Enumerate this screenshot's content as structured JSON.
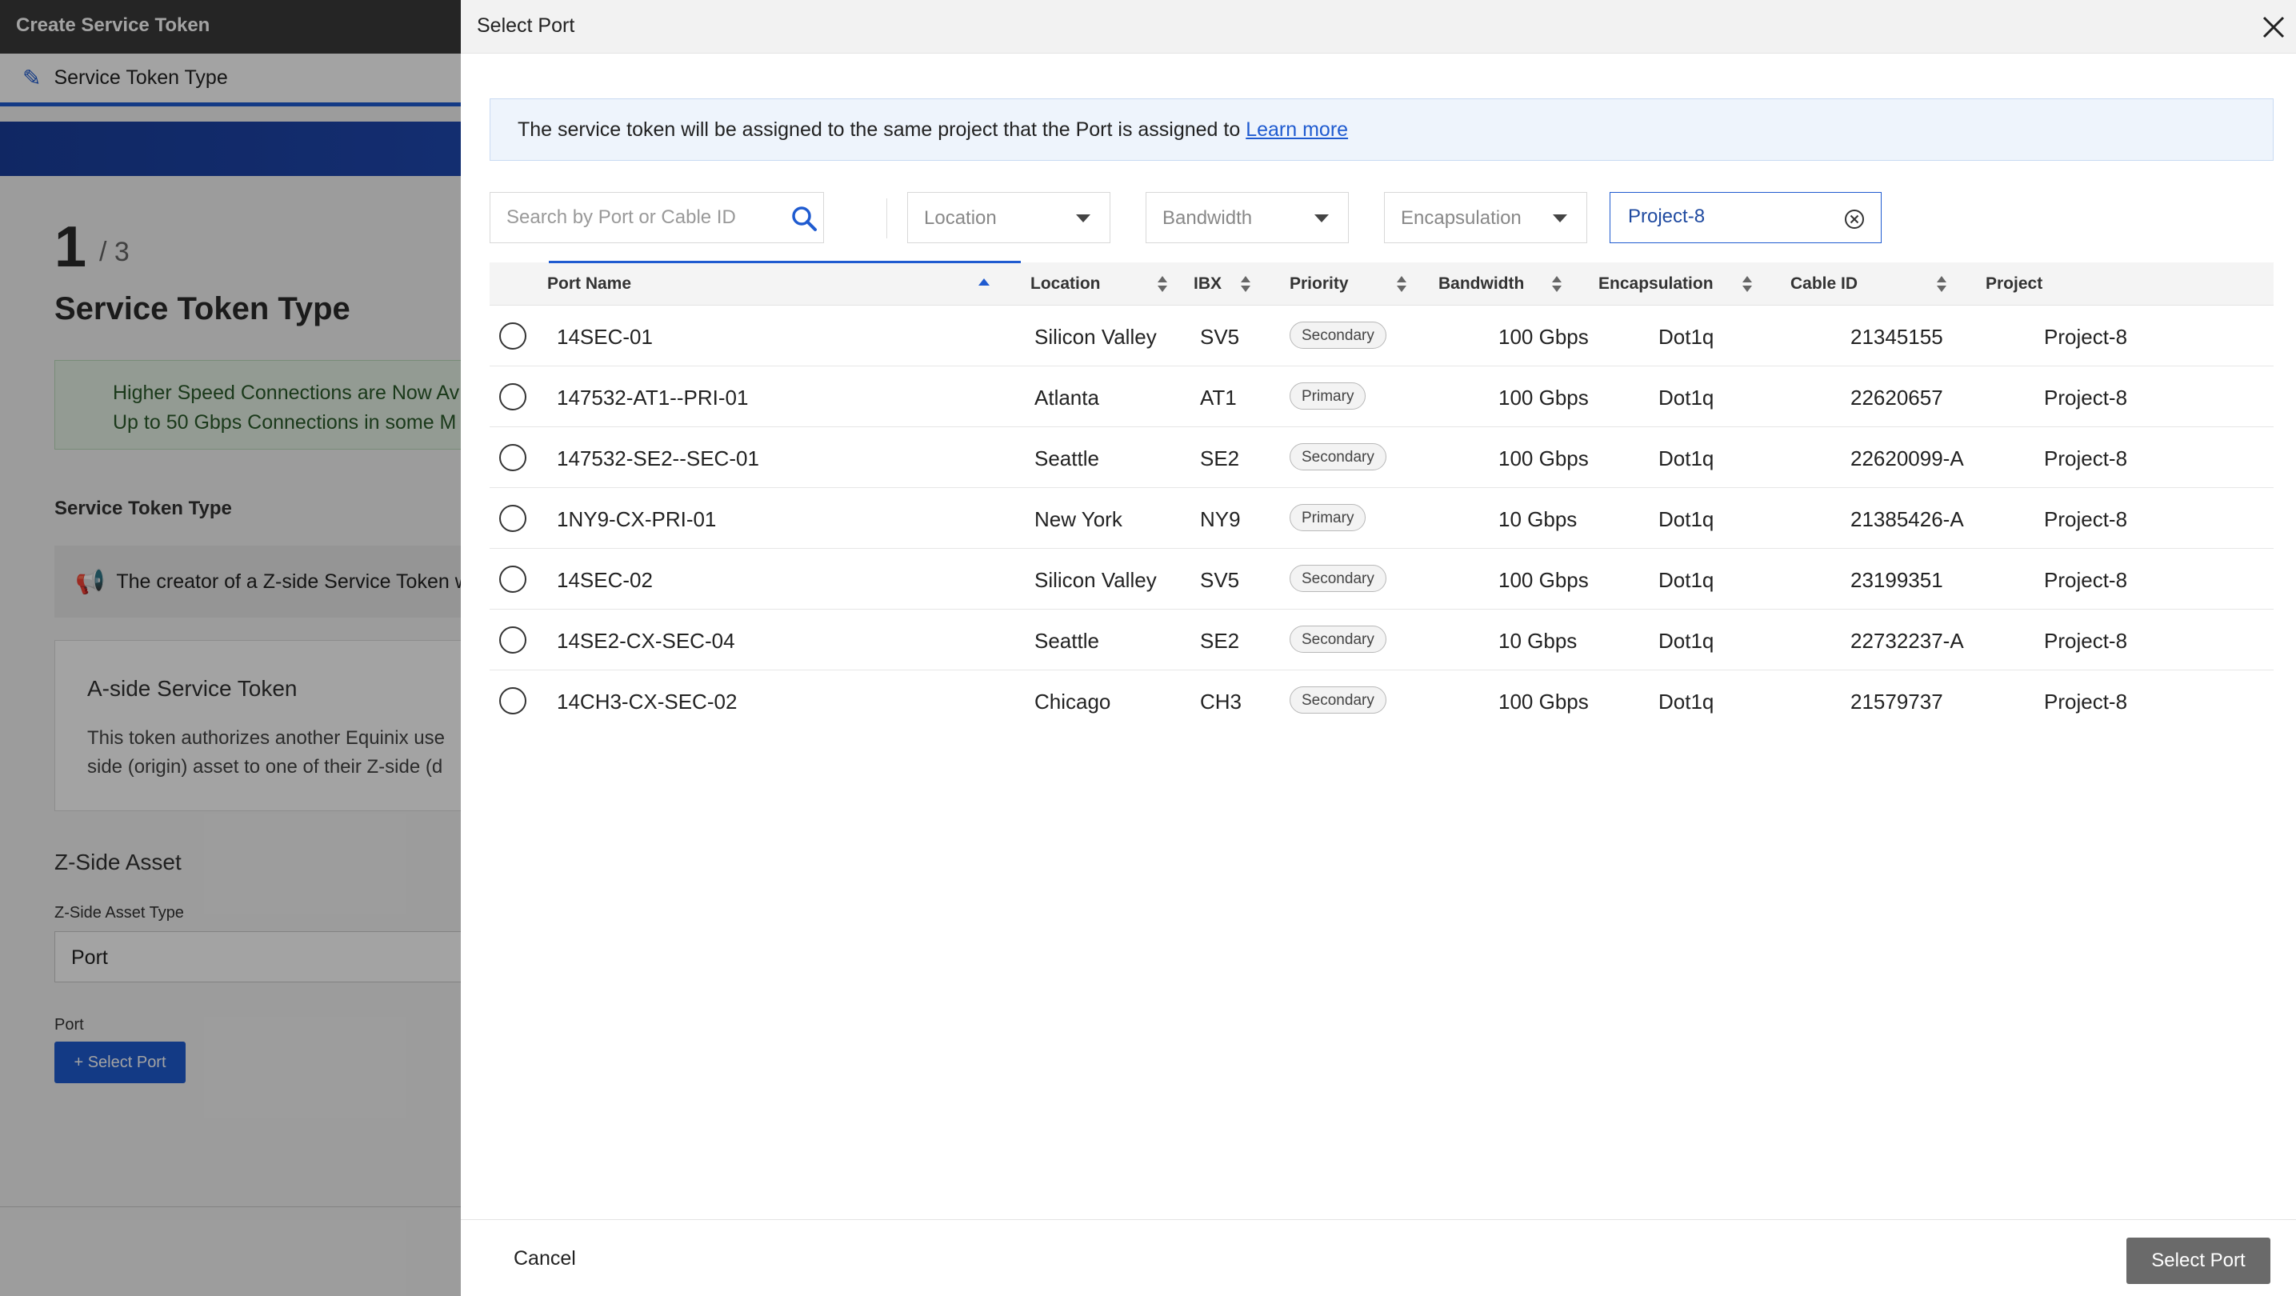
{
  "background": {
    "window_title": "Create Service Token",
    "step_label": "Service Token Type",
    "step_number": "1",
    "step_total": "/ 3",
    "page_title": "Service Token Type",
    "notice_line1": "Higher Speed Connections are Now Av",
    "notice_line2": "Up to 50 Gbps Connections in some M",
    "section_label": "Service Token Type",
    "info_text": "The creator of a Z-side Service Token w",
    "card_title": "A-side Service Token",
    "card_desc_line1": "This token authorizes another Equinix use",
    "card_desc_line2": "side (origin) asset to one of their Z-side (d",
    "zside_title": "Z-Side Asset",
    "zside_type_label": "Z-Side Asset Type",
    "zside_type_value": "Port",
    "port_label": "Port",
    "select_port_button": "+ Select Port"
  },
  "modal": {
    "title": "Select Port",
    "info_text": "The service token will be assigned to the same project that the Port is assigned to",
    "info_link": "Learn more",
    "filters": {
      "search_placeholder": "Search by Port or Cable ID",
      "location": "Location",
      "bandwidth": "Bandwidth",
      "encapsulation": "Encapsulation",
      "project": "Project-8"
    },
    "columns": {
      "port_name": "Port Name",
      "location": "Location",
      "ibx": "IBX",
      "priority": "Priority",
      "bandwidth": "Bandwidth",
      "encapsulation": "Encapsulation",
      "cable_id": "Cable ID",
      "project": "Project"
    },
    "rows": [
      {
        "name": "14SEC-01",
        "location": "Silicon Valley",
        "ibx": "SV5",
        "priority": "Secondary",
        "bandwidth": "100 Gbps",
        "encap": "Dot1q",
        "cable": "21345155",
        "project": "Project-8"
      },
      {
        "name": "147532-AT1--PRI-01",
        "location": "Atlanta",
        "ibx": "AT1",
        "priority": "Primary",
        "bandwidth": "100 Gbps",
        "encap": "Dot1q",
        "cable": "22620657",
        "project": "Project-8"
      },
      {
        "name": "147532-SE2--SEC-01",
        "location": "Seattle",
        "ibx": "SE2",
        "priority": "Secondary",
        "bandwidth": "100 Gbps",
        "encap": "Dot1q",
        "cable": "22620099-A",
        "project": "Project-8"
      },
      {
        "name": "1NY9-CX-PRI-01",
        "location": "New York",
        "ibx": "NY9",
        "priority": "Primary",
        "bandwidth": "10 Gbps",
        "encap": "Dot1q",
        "cable": "21385426-A",
        "project": "Project-8"
      },
      {
        "name": "14SEC-02",
        "location": "Silicon Valley",
        "ibx": "SV5",
        "priority": "Secondary",
        "bandwidth": "100 Gbps",
        "encap": "Dot1q",
        "cable": "23199351",
        "project": "Project-8"
      },
      {
        "name": "14SE2-CX-SEC-04",
        "location": "Seattle",
        "ibx": "SE2",
        "priority": "Secondary",
        "bandwidth": "10 Gbps",
        "encap": "Dot1q",
        "cable": "22732237-A",
        "project": "Project-8"
      },
      {
        "name": "14CH3-CX-SEC-02",
        "location": "Chicago",
        "ibx": "CH3",
        "priority": "Secondary",
        "bandwidth": "100 Gbps",
        "encap": "Dot1q",
        "cable": "21579737",
        "project": "Project-8"
      }
    ],
    "cancel_label": "Cancel",
    "select_label": "Select Port"
  },
  "colors": {
    "accent": "#1f5bd0",
    "primary_button_disabled": "#6a6a6a"
  }
}
